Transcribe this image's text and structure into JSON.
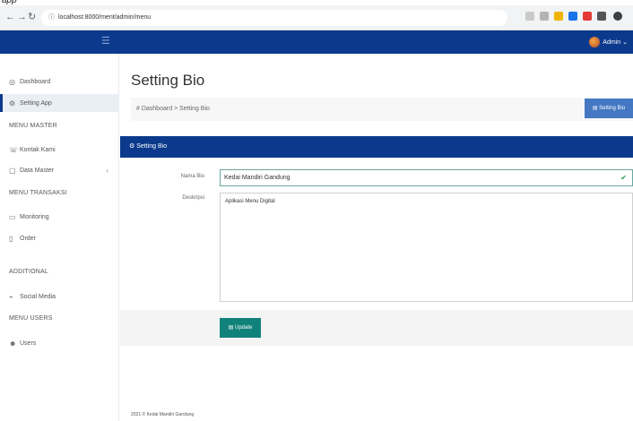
{
  "top_fragment": "app",
  "browser": {
    "url": "localhost:8000/ment/admin/menu",
    "extension_colors": [
      "#c9c9c9",
      "#b3b3b3",
      "#f0b400",
      "#1a73e8",
      "#e53935",
      "#555555",
      "#3c4043"
    ]
  },
  "appbar": {
    "hamburger_icon": "☰",
    "user_label": "Admin"
  },
  "sidebar": {
    "items": [
      {
        "icon": "◎",
        "label": "Dashboard"
      },
      {
        "icon": "⚙",
        "label": "Setting App"
      },
      {
        "icon": "☏",
        "label": "Kontak Kami"
      },
      {
        "icon": "▢",
        "label": "Data Master"
      },
      {
        "icon": "▭",
        "label": "Monitoring"
      },
      {
        "icon": "▯",
        "label": "Order"
      },
      {
        "icon": "⌁",
        "label": "Social Media"
      },
      {
        "icon": "☻",
        "label": "Users"
      }
    ],
    "headers": [
      "MENU MASTER",
      "MENU TRANSAKSI",
      "ADDITIONAL",
      "MENU USERS"
    ]
  },
  "main": {
    "title": "Setting Bio",
    "breadcrumb": "# Dashboard > Setting Bio",
    "bio_button": "Setting Bio",
    "card_title": "Setting Bio",
    "nama_label": "Nama Bio",
    "nama_value": "Kedai Mandiri Gandung",
    "desk_label": "Deskripsi",
    "desk_value": "Aplikasi Menu Digital",
    "update_button": "Update"
  },
  "footer": "2021 © Kedai Mandiri Gandung"
}
